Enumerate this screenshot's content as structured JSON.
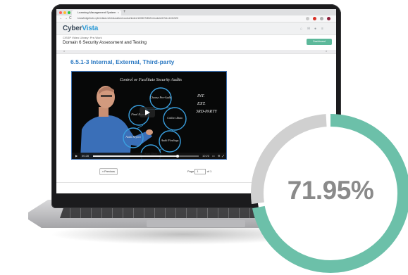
{
  "browser": {
    "tab_title": "Learning Management System",
    "tab_close": "×",
    "new_tab": "+",
    "url": "knowledgehub.cybervista.net/education/course/index/100507/8521/module/6?id=4131920",
    "nav": {
      "back": "←",
      "forward": "→",
      "reload": "C"
    },
    "colors": {
      "close": "#ff5f57",
      "min": "#febc2e",
      "max": "#28c840"
    }
  },
  "site": {
    "logo_part1": "Cyber",
    "logo_part2": "Vista",
    "course_subtitle": "CISSP Video Library: Pre-Work",
    "course_title": "Domain 6 Security Assessment and Testing",
    "dashboard_button": "Dashboard",
    "section_prev": "«",
    "section_next": "»"
  },
  "lesson": {
    "title": "6.5.1-3 Internal, External, Third-party"
  },
  "video": {
    "board_heading": "Control or Facilitate Security Audits",
    "bubbles": [
      "Choose Pro-Audit",
      "Final Report",
      "Collect Data",
      "Audit Report",
      "Audit Findings",
      "Scan Data"
    ],
    "side_note": [
      "INT.",
      "EXT.",
      "3RD-PARTY"
    ],
    "time_current": "00:28",
    "time_total": "10:23",
    "progress_fraction": 0.8
  },
  "pager": {
    "prev_label": "« Previous",
    "page_label": "Page",
    "page_value": "1",
    "of_label": "of 1"
  },
  "gauge": {
    "value_text": "71.95%",
    "fraction": 0.7195,
    "fill_color": "#6cc0a9",
    "track_color": "#d0d0d0"
  }
}
